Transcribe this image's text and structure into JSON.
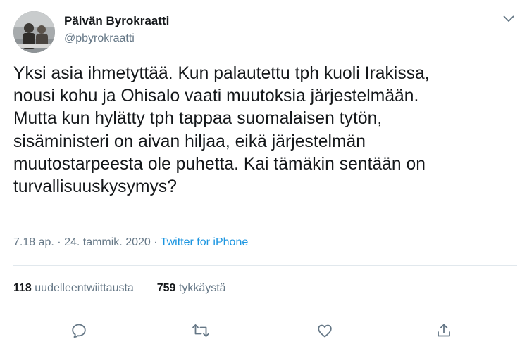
{
  "author": {
    "display_name": "Päivän Byrokraatti",
    "handle": "@pbyrokraatti"
  },
  "tweet": {
    "text": "Yksi asia ihmetyttää. Kun palautettu tph kuoli Irakissa,\nnousi kohu ja Ohisalo vaati muutoksia järjestelmään.\nMutta kun hylätty tph tappaa suomalaisen tytön,\nsisäministeri on aivan hiljaa, eikä järjestelmän\nmuutostarpeesta ole puhetta. Kai tämäkin sentään on\nturvallisuuskysymys?",
    "time": "7.18 ap.",
    "separator": "·",
    "date": "24. tammik. 2020",
    "source": "Twitter for iPhone"
  },
  "stats": {
    "retweets_count": "118",
    "retweets_label": "uudelleentwiittausta",
    "likes_count": "759",
    "likes_label": "tykkäystä"
  },
  "actions": {
    "icons": [
      "reply-icon",
      "retweet-icon",
      "like-icon",
      "share-icon"
    ]
  },
  "colors": {
    "text": "#14171a",
    "secondary": "#657786",
    "link": "#1b95e0",
    "divider": "#e1e8ed"
  }
}
